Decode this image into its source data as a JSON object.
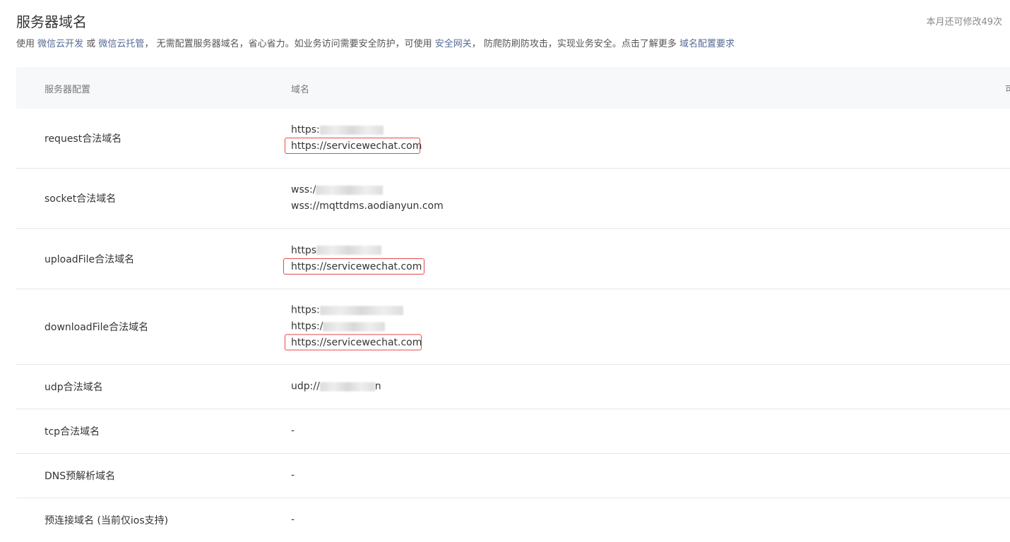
{
  "header": {
    "title": "服务器域名",
    "quota": "本月还可修改49次",
    "desc": {
      "p1": "使用 ",
      "link1": "微信云开发",
      "p2": " 或 ",
      "link2": "微信云托管",
      "p3": "， 无需配置服务器域名，省心省力。如业务访问需要安全防护，可使用 ",
      "link3": "安全网关",
      "p4": "， 防爬防刷防攻击，实现业务安全。点击了解更多 ",
      "link4": "域名配置要求"
    }
  },
  "table": {
    "col1": "服务器配置",
    "col2": "域名",
    "col3": "可",
    "rows": [
      {
        "label": "request合法域名",
        "values": [
          "https:",
          "https://servicewechat.com"
        ]
      },
      {
        "label": "socket合法域名",
        "values": [
          "wss:/",
          "wss://mqttdms.aodianyun.com"
        ]
      },
      {
        "label": "uploadFile合法域名",
        "values": [
          "https",
          "https://servicewechat.com"
        ]
      },
      {
        "label": "downloadFile合法域名",
        "values": [
          "https:",
          "https:/",
          "https://servicewechat.com"
        ]
      },
      {
        "label": "udp合法域名",
        "values": [
          "udp://",
          "n"
        ]
      },
      {
        "label": "tcp合法域名",
        "values": [
          "-"
        ]
      },
      {
        "label": "DNS预解析域名",
        "values": [
          "-"
        ]
      },
      {
        "label": "预连接域名 (当前仅ios支持)",
        "values": [
          "-"
        ]
      }
    ]
  },
  "colors": {
    "link": "#576b95",
    "highlight": "#e24a4a",
    "header_bg": "#f6f8f9"
  }
}
